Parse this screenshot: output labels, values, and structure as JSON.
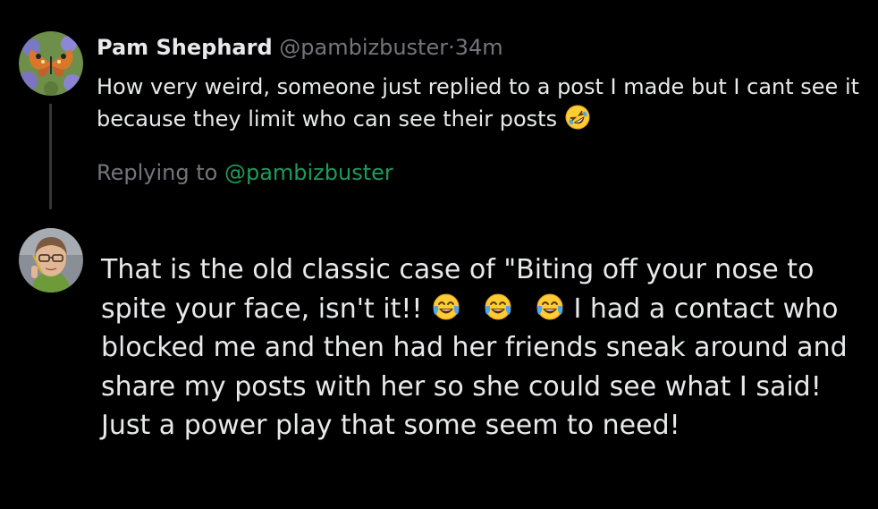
{
  "original_post": {
    "author_name": "Pam Shephard",
    "author_handle": "@pambizbuster",
    "separator": "·",
    "time": "34m",
    "text": "How very weird, someone just replied to a post I made but I cant see it because they limit who can see their posts",
    "emoji": "rolling-on-floor-laughing"
  },
  "reply": {
    "replying_label": "Replying to",
    "replying_handle": "@pambizbuster",
    "text_part1": "That is the old classic case of \"Biting off your nose to spite your face, isn't it!!",
    "emojis": [
      "face-with-tears-of-joy",
      "face-with-tears-of-joy",
      "face-with-tears-of-joy"
    ],
    "text_part2": "I had a contact who blocked me and then had her friends sneak around and share my posts with her so she could see what I said! Just a power play that some seem to need!"
  },
  "colors": {
    "background": "#000000",
    "primary_text": "#e7e9ea",
    "secondary_text": "#71767b",
    "mention": "#1d9b5a",
    "thread_line": "#333639"
  }
}
